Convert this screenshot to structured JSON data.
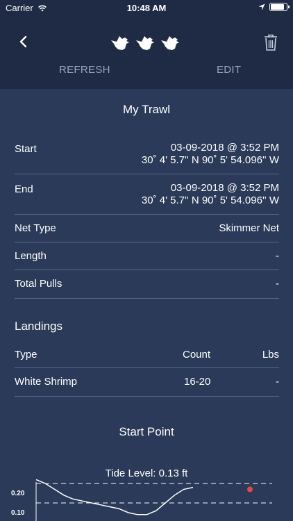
{
  "status_bar": {
    "carrier": "Carrier",
    "time": "10:48 AM"
  },
  "nav": {
    "refresh_label": "REFRESH",
    "edit_label": "EDIT",
    "back_icon": "chevron-left-icon",
    "delete_icon": "trash-icon",
    "logo_icon": "ducks-logo"
  },
  "trawl": {
    "title": "My Trawl",
    "start": {
      "label": "Start",
      "datetime": "03-09-2018 @ 3:52 PM",
      "coords": "30˚ 4' 5.7'' N  90˚ 5' 54.096'' W"
    },
    "end": {
      "label": "End",
      "datetime": "03-09-2018 @ 3:52 PM",
      "coords": "30˚ 4' 5.7'' N  90˚ 5' 54.096'' W"
    },
    "net_type": {
      "label": "Net Type",
      "value": "Skimmer Net"
    },
    "length": {
      "label": "Length",
      "value": "-"
    },
    "total_pulls": {
      "label": "Total Pulls",
      "value": "-"
    }
  },
  "landings": {
    "title": "Landings",
    "headers": {
      "type": "Type",
      "count": "Count",
      "lbs": "Lbs"
    },
    "rows": [
      {
        "type": "White Shrimp",
        "count": "16-20",
        "lbs": "-"
      }
    ]
  },
  "start_point": {
    "title": "Start Point",
    "tide_label": "Tide Level: 0.13 ft"
  },
  "chart_data": {
    "type": "line",
    "yticks": [
      "0.20",
      "0.10"
    ],
    "ylim": [
      0.05,
      0.25
    ],
    "series": [
      {
        "values": [
          0.22,
          0.2,
          0.17,
          0.14,
          0.12,
          0.11,
          0.1,
          0.09,
          0.08,
          0.07,
          0.05,
          0.04,
          0.04,
          0.06,
          0.1,
          0.14,
          0.17,
          0.18
        ]
      }
    ],
    "current_point": {
      "index": 15,
      "value": 0.17
    },
    "colors": {
      "line": "#ffffff",
      "marker": "#e04a4a",
      "gridline": "#ffffff"
    }
  },
  "colors": {
    "background": "#2a3a58",
    "header": "#1f2b44",
    "muted": "#9aa6bd"
  }
}
